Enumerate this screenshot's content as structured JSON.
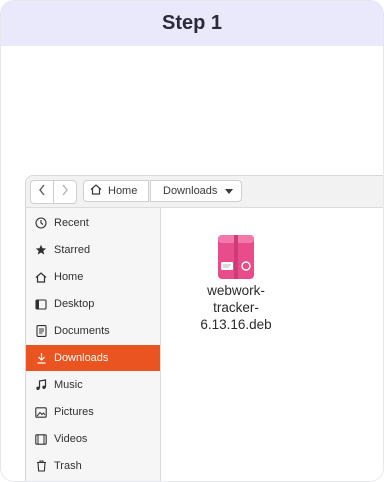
{
  "header": {
    "title": "Step 1"
  },
  "toolbar": {
    "back_icon": "chevron-left",
    "forward_icon": "chevron-right",
    "breadcrumbs": [
      "Home",
      "Downloads"
    ]
  },
  "sidebar": {
    "items": [
      {
        "label": "Recent",
        "icon": "clock-icon"
      },
      {
        "label": "Starred",
        "icon": "star-icon"
      },
      {
        "label": "Home",
        "icon": "home-icon"
      },
      {
        "label": "Desktop",
        "icon": "desktop-icon"
      },
      {
        "label": "Documents",
        "icon": "document-icon"
      },
      {
        "label": "Downloads",
        "icon": "download-icon",
        "active": true
      },
      {
        "label": "Music",
        "icon": "music-icon"
      },
      {
        "label": "Pictures",
        "icon": "picture-icon"
      },
      {
        "label": "Videos",
        "icon": "video-icon"
      },
      {
        "label": "Trash",
        "icon": "trash-icon"
      }
    ]
  },
  "files": [
    {
      "name": "webwork-tracker-6.13.16.deb",
      "type": "deb-package-icon"
    }
  ],
  "colors": {
    "accent": "#e95420",
    "header_bg": "#e9e9fb",
    "package_pink": "#e84c8a"
  }
}
